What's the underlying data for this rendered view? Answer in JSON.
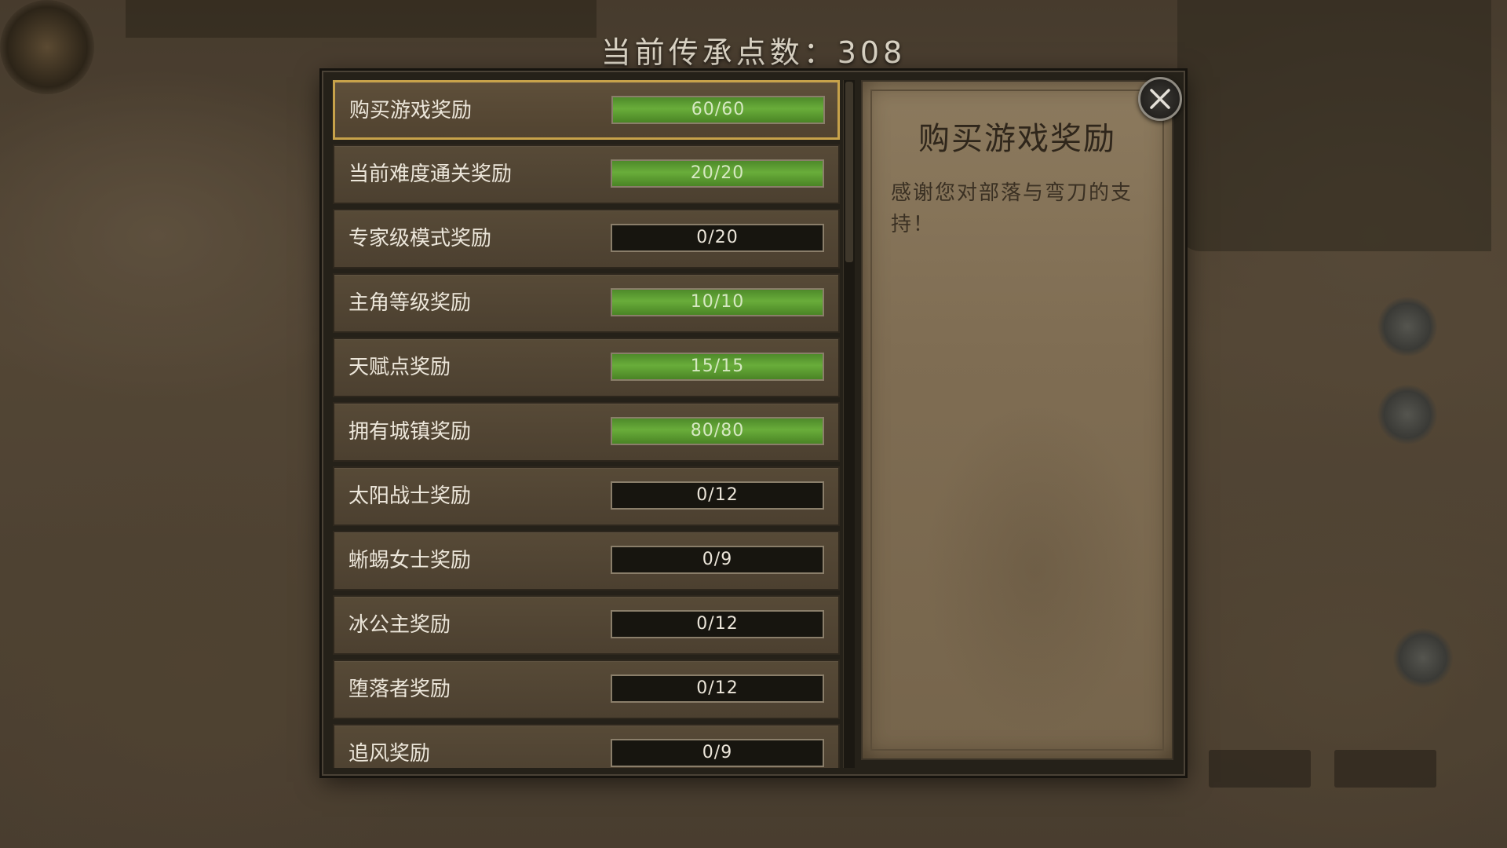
{
  "header": {
    "points_label": "当前传承点数：308"
  },
  "rewards": [
    {
      "label": "购买游戏奖励",
      "progress": "60/60",
      "fraction": 1.0,
      "selected": true
    },
    {
      "label": "当前难度通关奖励",
      "progress": "20/20",
      "fraction": 1.0,
      "selected": false
    },
    {
      "label": "专家级模式奖励",
      "progress": "0/20",
      "fraction": 0,
      "selected": false
    },
    {
      "label": "主角等级奖励",
      "progress": "10/10",
      "fraction": 1.0,
      "selected": false
    },
    {
      "label": "天赋点奖励",
      "progress": "15/15",
      "fraction": 1.0,
      "selected": false
    },
    {
      "label": "拥有城镇奖励",
      "progress": "80/80",
      "fraction": 1.0,
      "selected": false
    },
    {
      "label": "太阳战士奖励",
      "progress": "0/12",
      "fraction": 0,
      "selected": false
    },
    {
      "label": "蜥蜴女士奖励",
      "progress": "0/9",
      "fraction": 0,
      "selected": false
    },
    {
      "label": "冰公主奖励",
      "progress": "0/12",
      "fraction": 0,
      "selected": false
    },
    {
      "label": "堕落者奖励",
      "progress": "0/12",
      "fraction": 0,
      "selected": false
    },
    {
      "label": "追风奖励",
      "progress": "0/9",
      "fraction": 0,
      "selected": false
    }
  ],
  "detail": {
    "title": "购买游戏奖励",
    "description": "感谢您对部落与弯刀的支持！"
  },
  "icons": {
    "close": "close-icon"
  },
  "colors": {
    "progress_fill": "#5f9e33",
    "selected_border": "#c7a24a"
  }
}
